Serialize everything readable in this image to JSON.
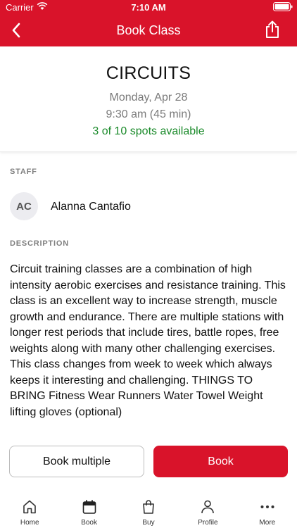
{
  "statusbar": {
    "carrier": "Carrier",
    "time": "7:10 AM"
  },
  "navbar": {
    "title": "Book Class"
  },
  "class": {
    "name": "CIRCUITS",
    "date": "Monday, Apr 28",
    "time": "9:30 am (45 min)",
    "spots": "3 of 10 spots available"
  },
  "staff": {
    "section_label": "STAFF",
    "initials": "AC",
    "name": "Alanna Cantafio"
  },
  "description": {
    "section_label": "DESCRIPTION",
    "text": "Circuit training classes are a combination of high intensity aerobic exercises and resistance training. This class is an excellent way to increase strength, muscle growth and endurance. There are multiple stations with longer rest periods that include tires, battle ropes, free weights along with many other challenging exercises. This class changes from week to week which always keeps it interesting and challenging. THINGS TO BRING Fitness Wear Runners Water Towel Weight lifting gloves (optional)"
  },
  "actions": {
    "book_multiple": "Book multiple",
    "book": "Book"
  },
  "tabs": [
    {
      "label": "Home",
      "icon": "home-icon"
    },
    {
      "label": "Book",
      "icon": "calendar-icon"
    },
    {
      "label": "Buy",
      "icon": "shopping-bag-icon"
    },
    {
      "label": "Profile",
      "icon": "person-icon"
    },
    {
      "label": "More",
      "icon": "more-dots-icon"
    }
  ],
  "colors": {
    "accent": "#d9132a",
    "available": "#1a8a2a",
    "muted": "#7a7a7a"
  }
}
